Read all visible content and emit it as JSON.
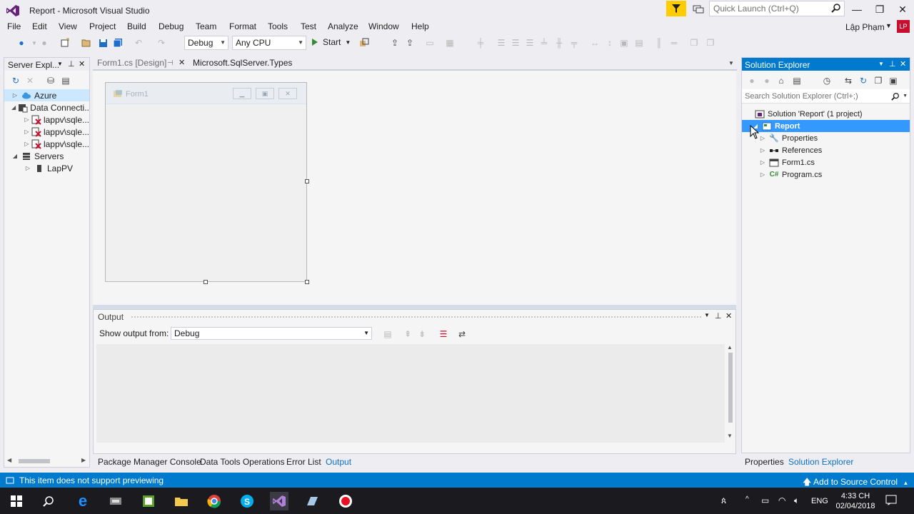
{
  "window": {
    "title": "Report - Microsoft Visual Studio"
  },
  "quick_launch": {
    "placeholder": "Quick Launch (Ctrl+Q)"
  },
  "menu": [
    "File",
    "Edit",
    "View",
    "Project",
    "Build",
    "Debug",
    "Team",
    "Format",
    "Tools",
    "Test",
    "Analyze",
    "Window",
    "Help"
  ],
  "user": {
    "name": "Lập Phạm",
    "initials": "LP"
  },
  "toolbar": {
    "config": "Debug",
    "platform": "Any CPU",
    "start_label": "Start"
  },
  "server_explorer": {
    "title": "Server Expl...",
    "tree": [
      {
        "label": "Azure",
        "selected": true
      },
      {
        "label": "Data Connecti..."
      },
      {
        "label": "lappv\\sqle..."
      },
      {
        "label": "lappv\\sqle..."
      },
      {
        "label": "lappv\\sqle..."
      },
      {
        "label": "Servers"
      },
      {
        "label": "LapPV"
      }
    ]
  },
  "doc_tabs": [
    {
      "label": "Form1.cs [Design]",
      "active": false
    },
    {
      "label": "Microsoft.SqlServer.Types",
      "active": true
    }
  ],
  "designer": {
    "form_title": "Form1"
  },
  "output": {
    "title": "Output",
    "show_label": "Show output from:",
    "source": "Debug"
  },
  "bottom_tabs": [
    "Package Manager Console",
    "Data Tools Operations",
    "Error List",
    "Output"
  ],
  "solution_explorer": {
    "title": "Solution Explorer",
    "search_placeholder": "Search Solution Explorer (Ctrl+;)",
    "solution_label": "Solution 'Report' (1 project)",
    "project_label": "Report",
    "items": [
      "Properties",
      "References",
      "Form1.cs",
      "Program.cs"
    ]
  },
  "right_bottom_tabs": [
    "Properties",
    "Solution Explorer"
  ],
  "status": {
    "text": "This item does not support previewing",
    "source_control": "Add to Source Control"
  },
  "taskbar": {
    "lang": "ENG",
    "time": "4:33 CH",
    "date": "02/04/2018"
  },
  "colors": {
    "accent": "#007acc",
    "selection": "#3399ff",
    "filter": "#ffcc00"
  }
}
